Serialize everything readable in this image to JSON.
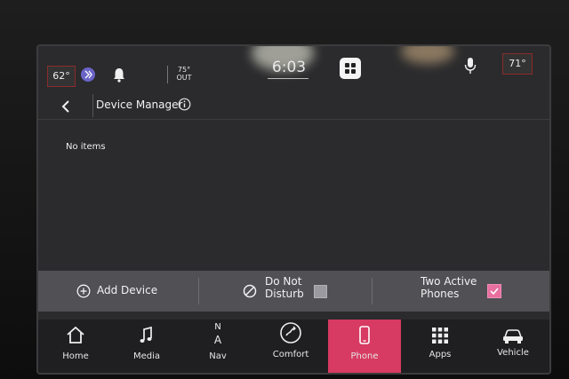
{
  "status": {
    "left_temp": "62°",
    "out_temp": "75°",
    "out_label": "OUT",
    "clock": "6:03",
    "right_temp": "71°"
  },
  "header": {
    "title": "Device Manager"
  },
  "content": {
    "empty_text": "No items"
  },
  "actions": {
    "add_device": "Add Device",
    "dnd_line1": "Do Not",
    "dnd_line2": "Disturb",
    "dnd_checked": false,
    "two_active_line1": "Two Active",
    "two_active_line2": "Phones",
    "two_active_checked": true
  },
  "nav": {
    "items": [
      {
        "label": "Home",
        "icon": "home-icon"
      },
      {
        "label": "Media",
        "icon": "music-note-icon"
      },
      {
        "label": "Nav",
        "icon": "compass-icon",
        "compass_letters": [
          "N",
          "A"
        ]
      },
      {
        "label": "Comfort",
        "icon": "climate-icon"
      },
      {
        "label": "Phone",
        "icon": "phone-icon",
        "active": true
      },
      {
        "label": "Apps",
        "icon": "apps-grid-icon"
      },
      {
        "label": "Vehicle",
        "icon": "car-icon"
      }
    ]
  },
  "colors": {
    "active_tab": "#d73a62",
    "checkbox_checked": "#e86fa0",
    "temp_border": "#8a2b2b"
  }
}
